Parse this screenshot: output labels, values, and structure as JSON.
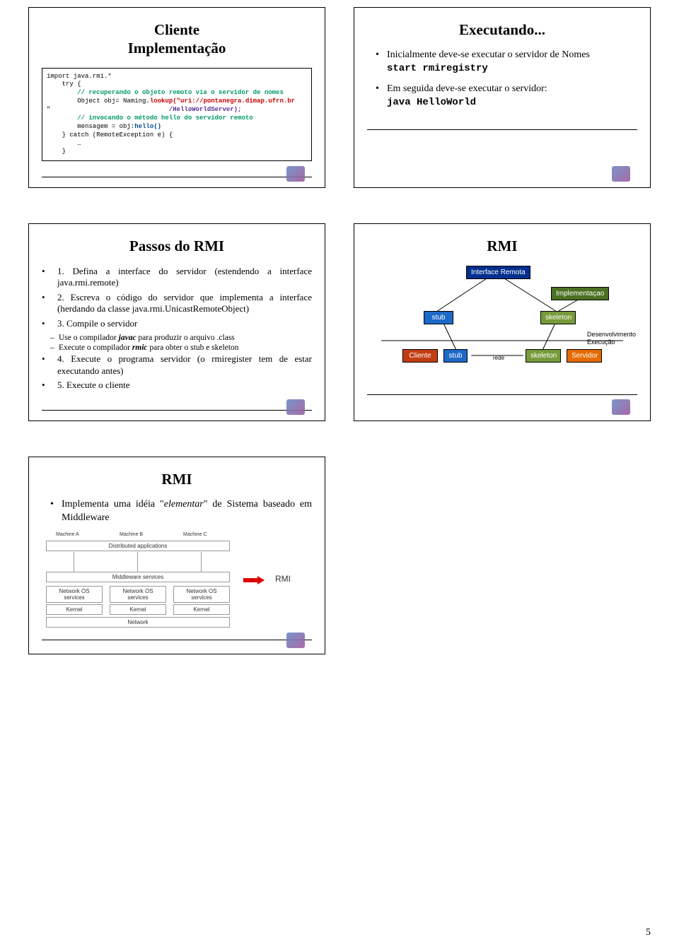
{
  "pageNumber": "5",
  "slides": {
    "s1": {
      "title": "Cliente\nImplementação",
      "code": {
        "l1": "import java.rmi.*",
        "l2": "    try {",
        "l3": "        // recuperando o objeto remoto via o servidor de nomes",
        "l4a": "        Object obj= Naming.",
        "l4b": "lookup(\"uri://pontanegra.dimap.ufrn.br",
        "l5a": "\"                               ",
        "l5b": "/HelloWorldServer);",
        "l6": "        // invocando o método hello do servidor remoto",
        "l7a": "        mensagem = obj:",
        "l7b": "hello()",
        "l8": "    } catch (RemoteException e) {",
        "l9": "        …",
        "l10": "    }"
      }
    },
    "s2": {
      "title": "Executando...",
      "b1": "Inicialmente deve-se executar o servidor de Nomes",
      "b1code": "start rmiregistry",
      "b2": "Em seguida deve-se executar o servidor:",
      "b2code": "java HelloWorld"
    },
    "s3": {
      "title": "Passos do RMI",
      "items": {
        "i1": "1. Defina a interface do servidor (estendendo a interface java.rmi.remote)",
        "i2": "2. Escreva o código do servidor que implementa a interface (herdando da classe java.rmi.UnicastRemoteObject)",
        "i3": "3. Compile o servidor",
        "i3s1a": "Use o compilador ",
        "i3s1b": "javac",
        "i3s1c": " para produzir o arquivo .class",
        "i3s2a": "Execute o compilador ",
        "i3s2b": "rmic",
        "i3s2c": " para obter o stub e skeleton",
        "i4": "4. Execute o programa servidor (o rmiregister tem de estar executando antes)",
        "i5": "5. Execute o cliente"
      }
    },
    "s4": {
      "title": "RMI",
      "boxes": {
        "if": "Interface Remota",
        "impl": "Implementaçao",
        "stub": "stub",
        "skel": "skeleton",
        "cli": "Cliente",
        "stub2": "stub",
        "rede": "rede",
        "skel2": "skeleton",
        "srv": "Servidor"
      },
      "labels": {
        "dev": "Desenvolvimento",
        "exe": "Execução"
      }
    },
    "s5": {
      "title": "RMI",
      "b1a": "Implementa uma idéia \"",
      "b1b": "elementar",
      "b1c": "\" de Sistema baseado em Middleware",
      "mw": {
        "ma": "Machine A",
        "mb": "Machine B",
        "mc": "Machine C",
        "da": "Distributed applications",
        "ms": "Middleware services",
        "nos": "Network OS\nservices",
        "kernel": "Kernel",
        "net": "Network",
        "label": "RMI"
      }
    }
  }
}
